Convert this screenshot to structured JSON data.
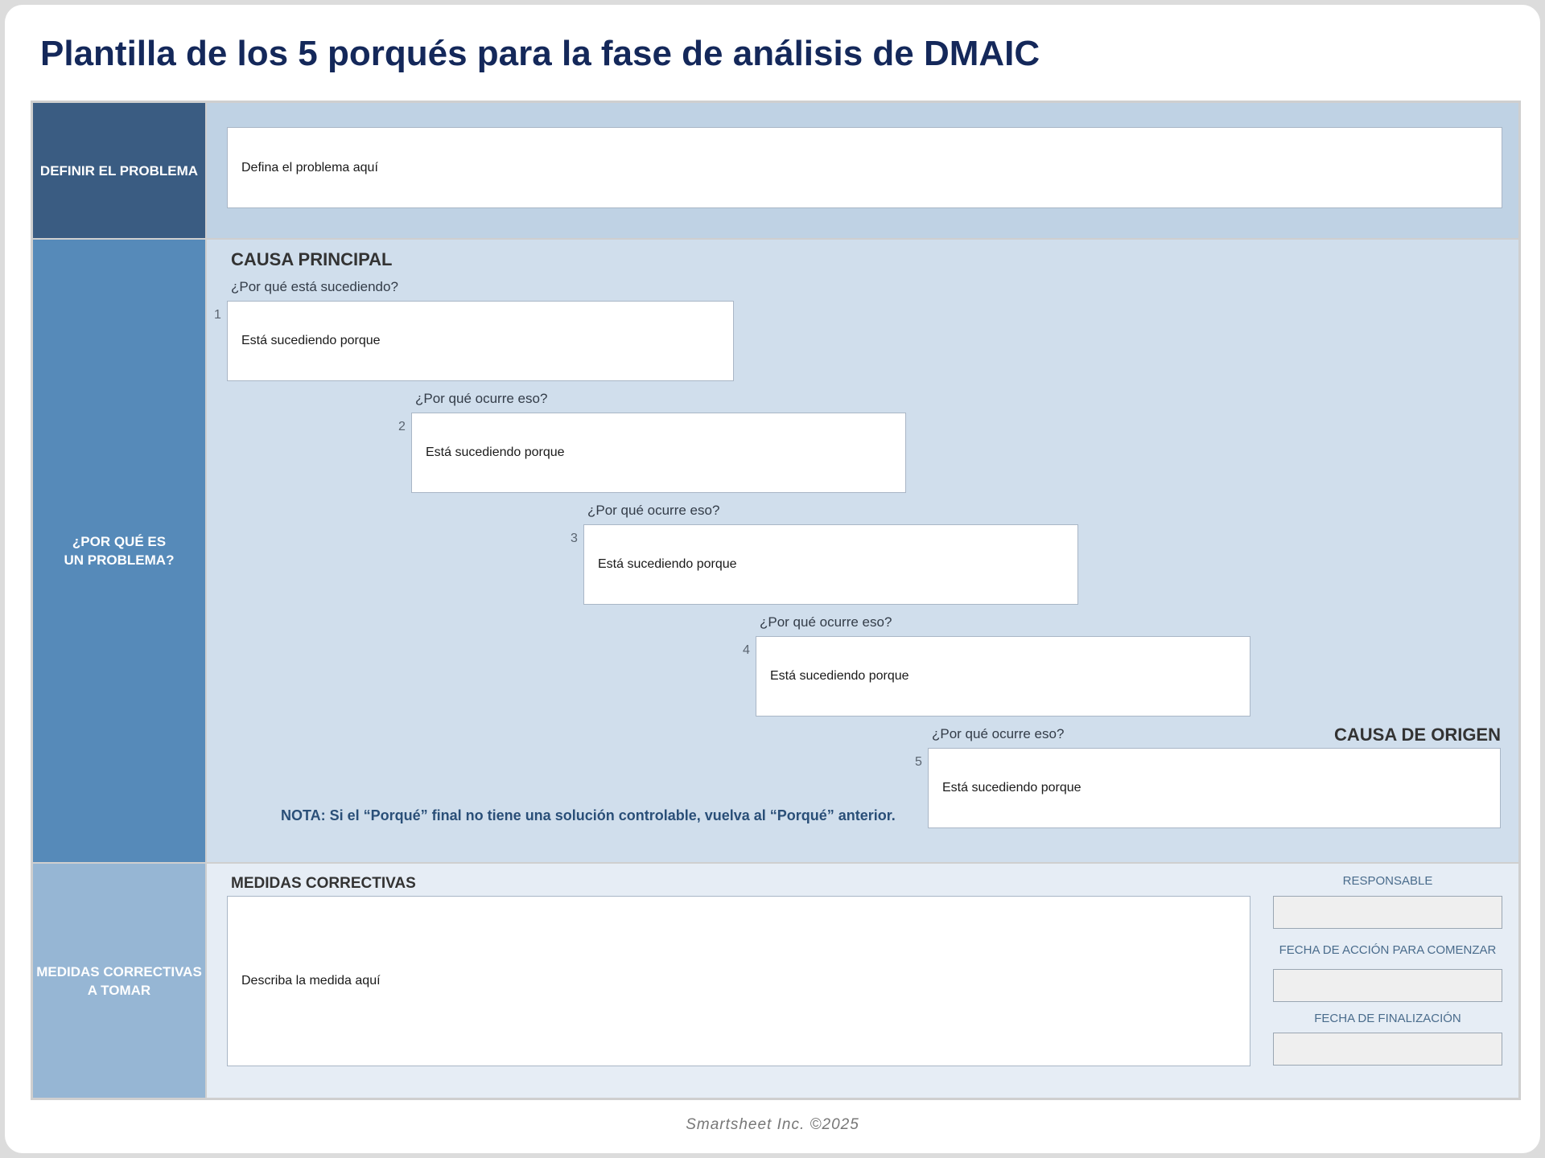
{
  "title": "Plantilla de los 5 porqués para la fase de análisis de DMAIC",
  "define": {
    "side_label": "DEFINIR EL PROBLEMA",
    "placeholder": "Defina el problema aquí"
  },
  "why": {
    "side_label_line1": "¿POR QUÉ ES",
    "side_label_line2": "UN PROBLEMA?",
    "principal_heading": "CAUSA PRINCIPAL",
    "origin_heading": "CAUSA DE ORIGEN",
    "steps": [
      {
        "number": "1",
        "question": "¿Por qué está sucediendo?",
        "answer": "Está sucediendo porque"
      },
      {
        "number": "2",
        "question": "¿Por qué ocurre eso?",
        "answer": "Está sucediendo porque"
      },
      {
        "number": "3",
        "question": "¿Por qué ocurre eso?",
        "answer": "Está sucediendo porque"
      },
      {
        "number": "4",
        "question": "¿Por qué ocurre eso?",
        "answer": "Está sucediendo porque"
      },
      {
        "number": "5",
        "question": "¿Por qué ocurre eso?",
        "answer": "Está sucediendo porque"
      }
    ],
    "note": "NOTA: Si el “Porqué” final no tiene una solución controlable, vuelva al “Porqué” anterior."
  },
  "corrective": {
    "side_label_line1": "MEDIDAS CORRECTIVAS",
    "side_label_line2": "A TOMAR",
    "heading": "MEDIDAS CORRECTIVAS",
    "placeholder": "Describa la medida aquí",
    "responsible_label": "RESPONSABLE",
    "start_date_label": "FECHA DE ACCIÓN PARA COMENZAR",
    "end_date_label": "FECHA DE FINALIZACIÓN"
  },
  "footer": "Smartsheet Inc. ©2025",
  "colors": {
    "title": "#14285a",
    "define_side": "#3a5c82",
    "why_side": "#568ab9",
    "corrective_side": "#96b6d4"
  }
}
